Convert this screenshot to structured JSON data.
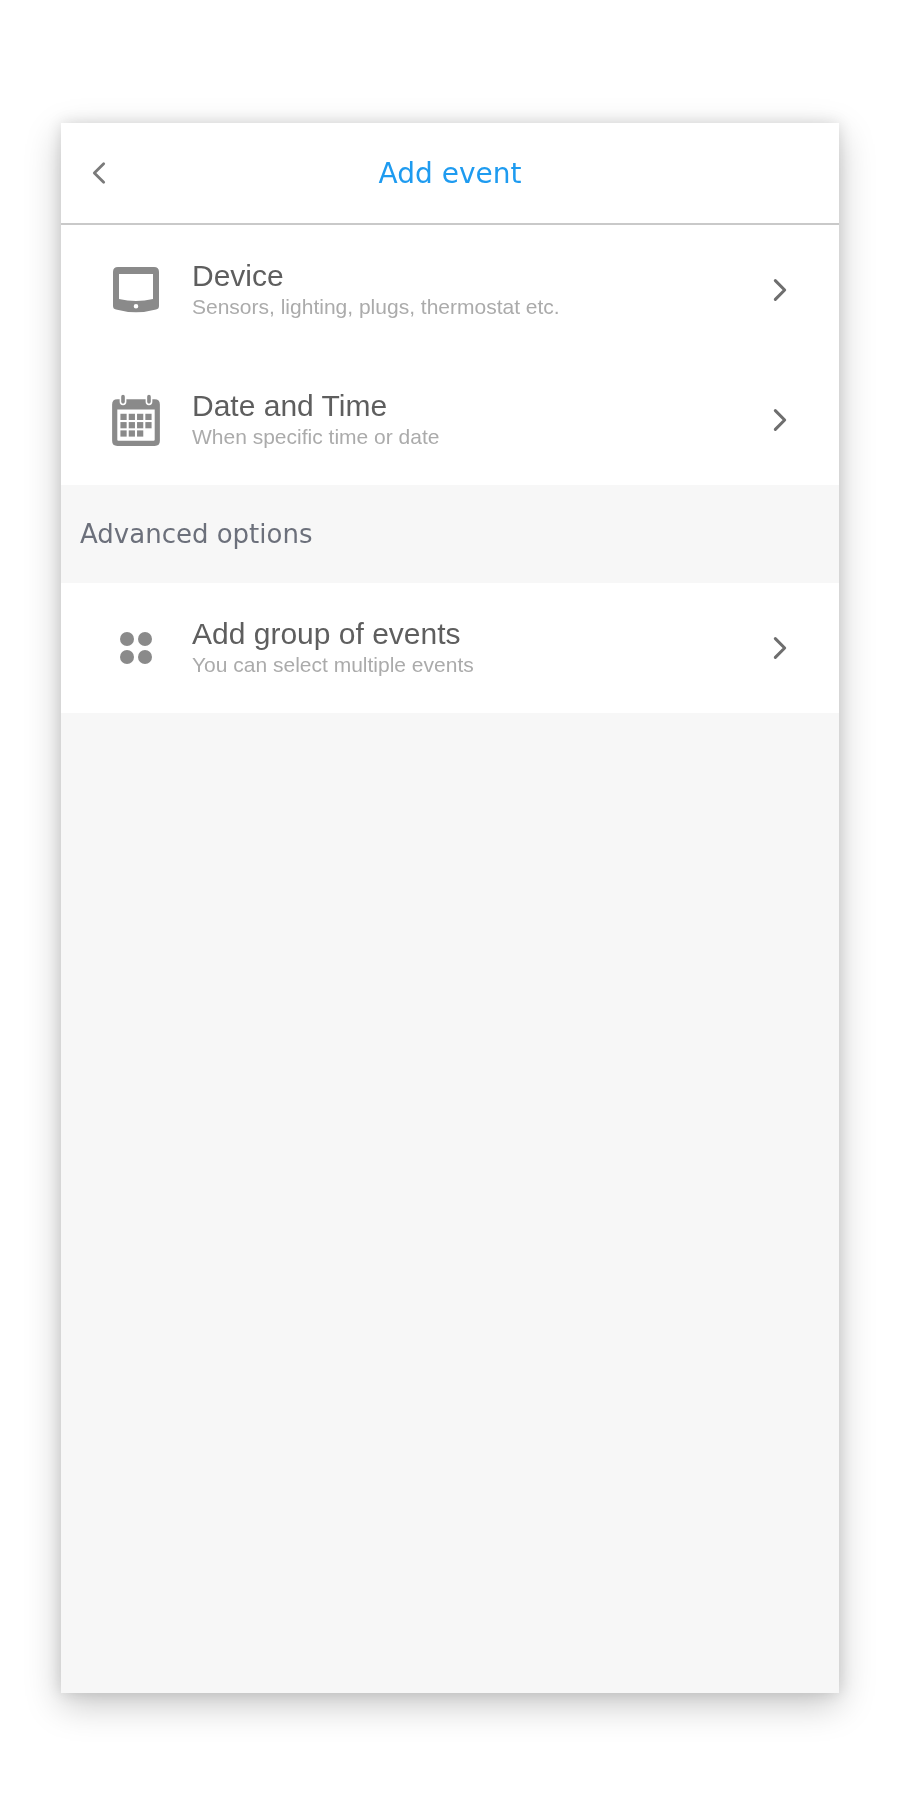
{
  "header": {
    "title": "Add event"
  },
  "items": [
    {
      "kind": "device",
      "title": "Device",
      "subtitle": "Sensors, lighting, plugs, thermostat etc."
    },
    {
      "kind": "calendar",
      "title": "Date and Time",
      "subtitle": "When specific time or date"
    }
  ],
  "advanced": {
    "heading": "Advanced options",
    "items": [
      {
        "kind": "group",
        "title": "Add group of events",
        "subtitle": "You can select multiple events"
      }
    ]
  }
}
